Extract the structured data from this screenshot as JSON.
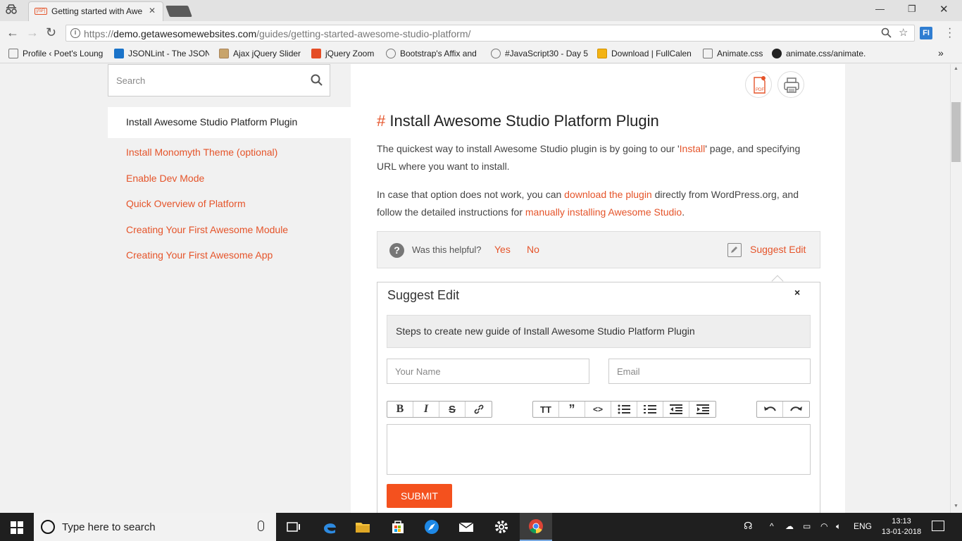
{
  "browser": {
    "tab_title": "Getting started with Awe",
    "tab_favicon_text": "[/SF]",
    "url_protocol": "https://",
    "url_domain": "demo.getawesomewebsites.com",
    "url_path": "/guides/getting-started-awesome-studio-platform/",
    "extension_label": "FI",
    "bookmarks": [
      {
        "label": "Profile ‹ Poet's Loung",
        "icon": "page-icon"
      },
      {
        "label": "JSONLint - The JSON",
        "icon": "jsonlint-icon"
      },
      {
        "label": "Ajax jQuery Slider",
        "icon": "slider-icon"
      },
      {
        "label": "jQuery Zoom",
        "icon": "zoom-icon"
      },
      {
        "label": "Bootstrap's Affix and",
        "icon": "codepen-icon"
      },
      {
        "label": "#JavaScript30 - Day 5",
        "icon": "codepen-icon"
      },
      {
        "label": "Download | FullCalen",
        "icon": "calendar-icon"
      },
      {
        "label": "Animate.css",
        "icon": "page-icon"
      },
      {
        "label": "animate.css/animate.",
        "icon": "github-icon"
      }
    ]
  },
  "sidebar": {
    "search_placeholder": "Search",
    "active_item": "Install Awesome Studio Platform Plugin",
    "items": [
      "Install Monomyth Theme (optional)",
      "Enable Dev Mode",
      "Quick Overview of Platform",
      "Creating Your First Awesome Module",
      "Creating Your First Awesome App"
    ]
  },
  "article": {
    "heading_hash": "#",
    "heading": "Install Awesome Studio Platform Plugin",
    "p1_a": "The quickest way to install Awesome Studio plugin is by going to our '",
    "p1_link": "Install",
    "p1_b": "' page, and specifying URL where you want to install.",
    "p2_a": "In case that option does not work, you can ",
    "p2_link1": "download the plugin",
    "p2_b": " directly from WordPress.org, and follow the detailed instructions for ",
    "p2_link2": "manually installing Awesome Studio",
    "p2_c": "."
  },
  "feedback": {
    "question": "Was this helpful?",
    "yes": "Yes",
    "no": "No",
    "suggest_edit": "Suggest Edit"
  },
  "suggest_form": {
    "title": "Suggest Edit",
    "close": "×",
    "steps_text": "Steps to create new guide of Install Awesome Studio Platform Plugin",
    "name_placeholder": "Your Name",
    "email_placeholder": "Email",
    "submit": "SUBMIT"
  },
  "taskbar": {
    "search_text": "Type here to search",
    "language": "ENG",
    "time": "13:13",
    "date": "13-01-2018"
  },
  "colors": {
    "accent": "#e5542a",
    "submit": "#f4511e"
  }
}
